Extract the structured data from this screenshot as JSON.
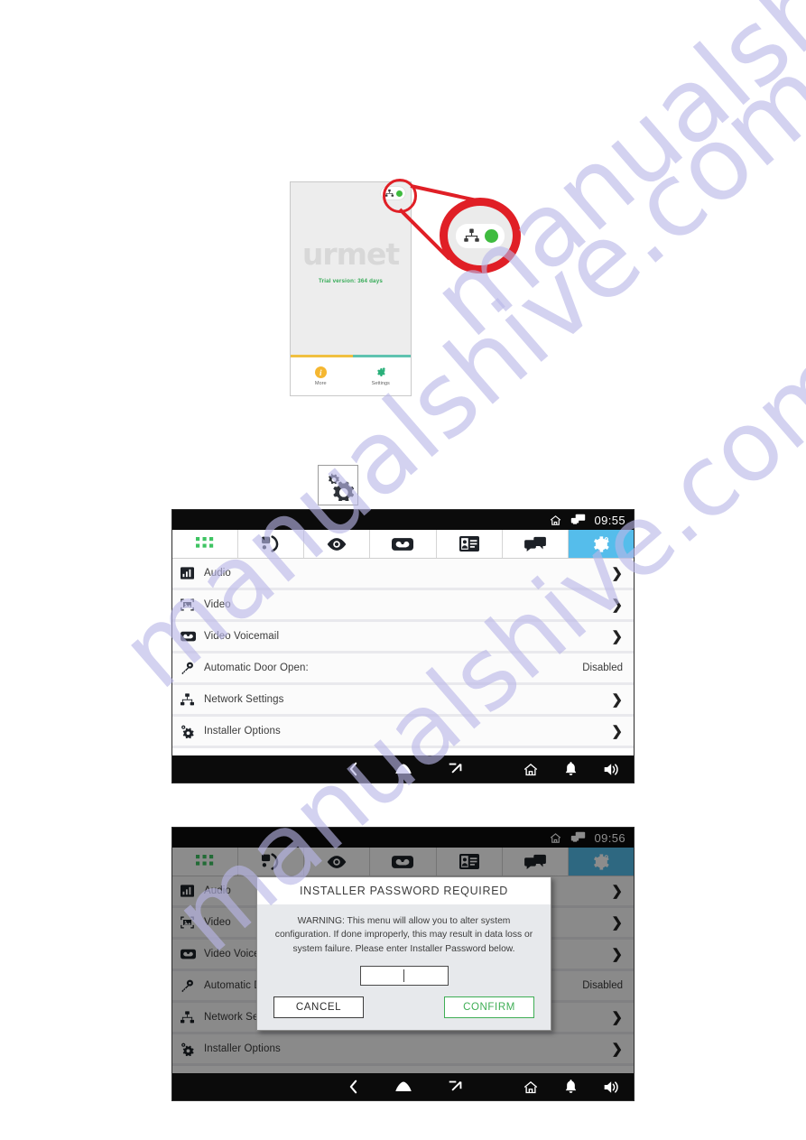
{
  "watermark": {
    "line1": "manualshive.com",
    "line2": "manualshive.com",
    "line3": "manualshive.com"
  },
  "phone_mockup": {
    "brand_logo": "urmet",
    "trial_text": "Trial version: 364 days",
    "status_chip": {
      "network_icon": "ethernet-icon",
      "status_dot_color": "#3fbb3f"
    },
    "tabs": [
      {
        "label": "More",
        "icon": "info-icon"
      },
      {
        "label": "Settings",
        "icon": "gear-icon"
      }
    ],
    "progress": {
      "left_color": "#f0c040",
      "right_color": "#5fc3b0"
    }
  },
  "callout": {
    "circle_color": "#e01f26",
    "magnified_icon": "ethernet-icon",
    "magnified_dot_color": "#3fbb3f"
  },
  "gear_badge": {
    "icon": "settings-gears-icon"
  },
  "device_1": {
    "statusbar": {
      "time": "09:55",
      "icons": [
        "home-icon",
        "monitor-icon"
      ]
    },
    "tabs": [
      {
        "name": "keypad",
        "icon": "keypad-icon",
        "active": false
      },
      {
        "name": "call",
        "icon": "call-icon",
        "active": false
      },
      {
        "name": "view",
        "icon": "eye-icon",
        "active": false
      },
      {
        "name": "voicemail",
        "icon": "cassette-icon",
        "active": false
      },
      {
        "name": "contacts",
        "icon": "contact-card-icon",
        "active": false
      },
      {
        "name": "messages",
        "icon": "chat-bubbles-icon",
        "active": false
      },
      {
        "name": "settings",
        "icon": "gear-icon",
        "active": true
      }
    ],
    "active_tab_color": "#55bdeb",
    "rows": [
      {
        "icon": "equalizer-icon",
        "label": "Audio",
        "value": "",
        "chevron": true
      },
      {
        "icon": "image-frame-icon",
        "label": "Video",
        "value": "",
        "chevron": true
      },
      {
        "icon": "cassette-icon",
        "label": "Video Voicemail",
        "value": "",
        "chevron": true
      },
      {
        "icon": "key-icon",
        "label": "Automatic Door Open:",
        "value": "Disabled",
        "chevron": false
      },
      {
        "icon": "network-tree-icon",
        "label": "Network Settings",
        "value": "",
        "chevron": true
      },
      {
        "icon": "settings-gears-icon",
        "label": "Installer Options",
        "value": "",
        "chevron": true
      }
    ],
    "navbar": {
      "buttons": [
        "back-icon",
        "home-icon",
        "recents-icon"
      ],
      "right_icons": [
        "house-icon",
        "bell-icon",
        "speaker-icon"
      ]
    }
  },
  "device_2": {
    "statusbar": {
      "time": "09:56",
      "icons": [
        "home-icon",
        "monitor-icon"
      ]
    },
    "tabs": [
      {
        "name": "keypad",
        "icon": "keypad-icon",
        "active": false
      },
      {
        "name": "call",
        "icon": "call-icon",
        "active": false
      },
      {
        "name": "view",
        "icon": "eye-icon",
        "active": false
      },
      {
        "name": "voicemail",
        "icon": "cassette-icon",
        "active": false
      },
      {
        "name": "contacts",
        "icon": "contact-card-icon",
        "active": false
      },
      {
        "name": "messages",
        "icon": "chat-bubbles-icon",
        "active": false
      },
      {
        "name": "settings",
        "icon": "gear-icon",
        "active": true
      }
    ],
    "rows": [
      {
        "icon": "equalizer-icon",
        "label": "Audio",
        "value": "",
        "chevron": true
      },
      {
        "icon": "image-frame-icon",
        "label": "Video",
        "value": "",
        "chevron": true
      },
      {
        "icon": "cassette-icon",
        "label": "Video Voicemail",
        "value": "",
        "chevron": true
      },
      {
        "icon": "key-icon",
        "label": "Automatic Door Open:",
        "value": "Disabled",
        "chevron": false
      },
      {
        "icon": "network-tree-icon",
        "label": "Network Settings",
        "value": "",
        "chevron": true
      },
      {
        "icon": "settings-gears-icon",
        "label": "Installer Options",
        "value": "",
        "chevron": true
      }
    ],
    "dialog": {
      "title": "INSTALLER PASSWORD REQUIRED",
      "warning": "WARNING: This menu will allow you to alter system configuration. If done improperly, this may result in data loss or system failure. Please enter Installer Password below.",
      "password_value": "",
      "password_placeholder": "",
      "cancel_label": "CANCEL",
      "confirm_label": "CONFIRM",
      "confirm_color": "#3fae55"
    },
    "navbar": {
      "buttons": [
        "back-icon",
        "home-icon",
        "recents-icon"
      ],
      "right_icons": [
        "house-icon",
        "bell-icon",
        "speaker-icon"
      ]
    }
  }
}
